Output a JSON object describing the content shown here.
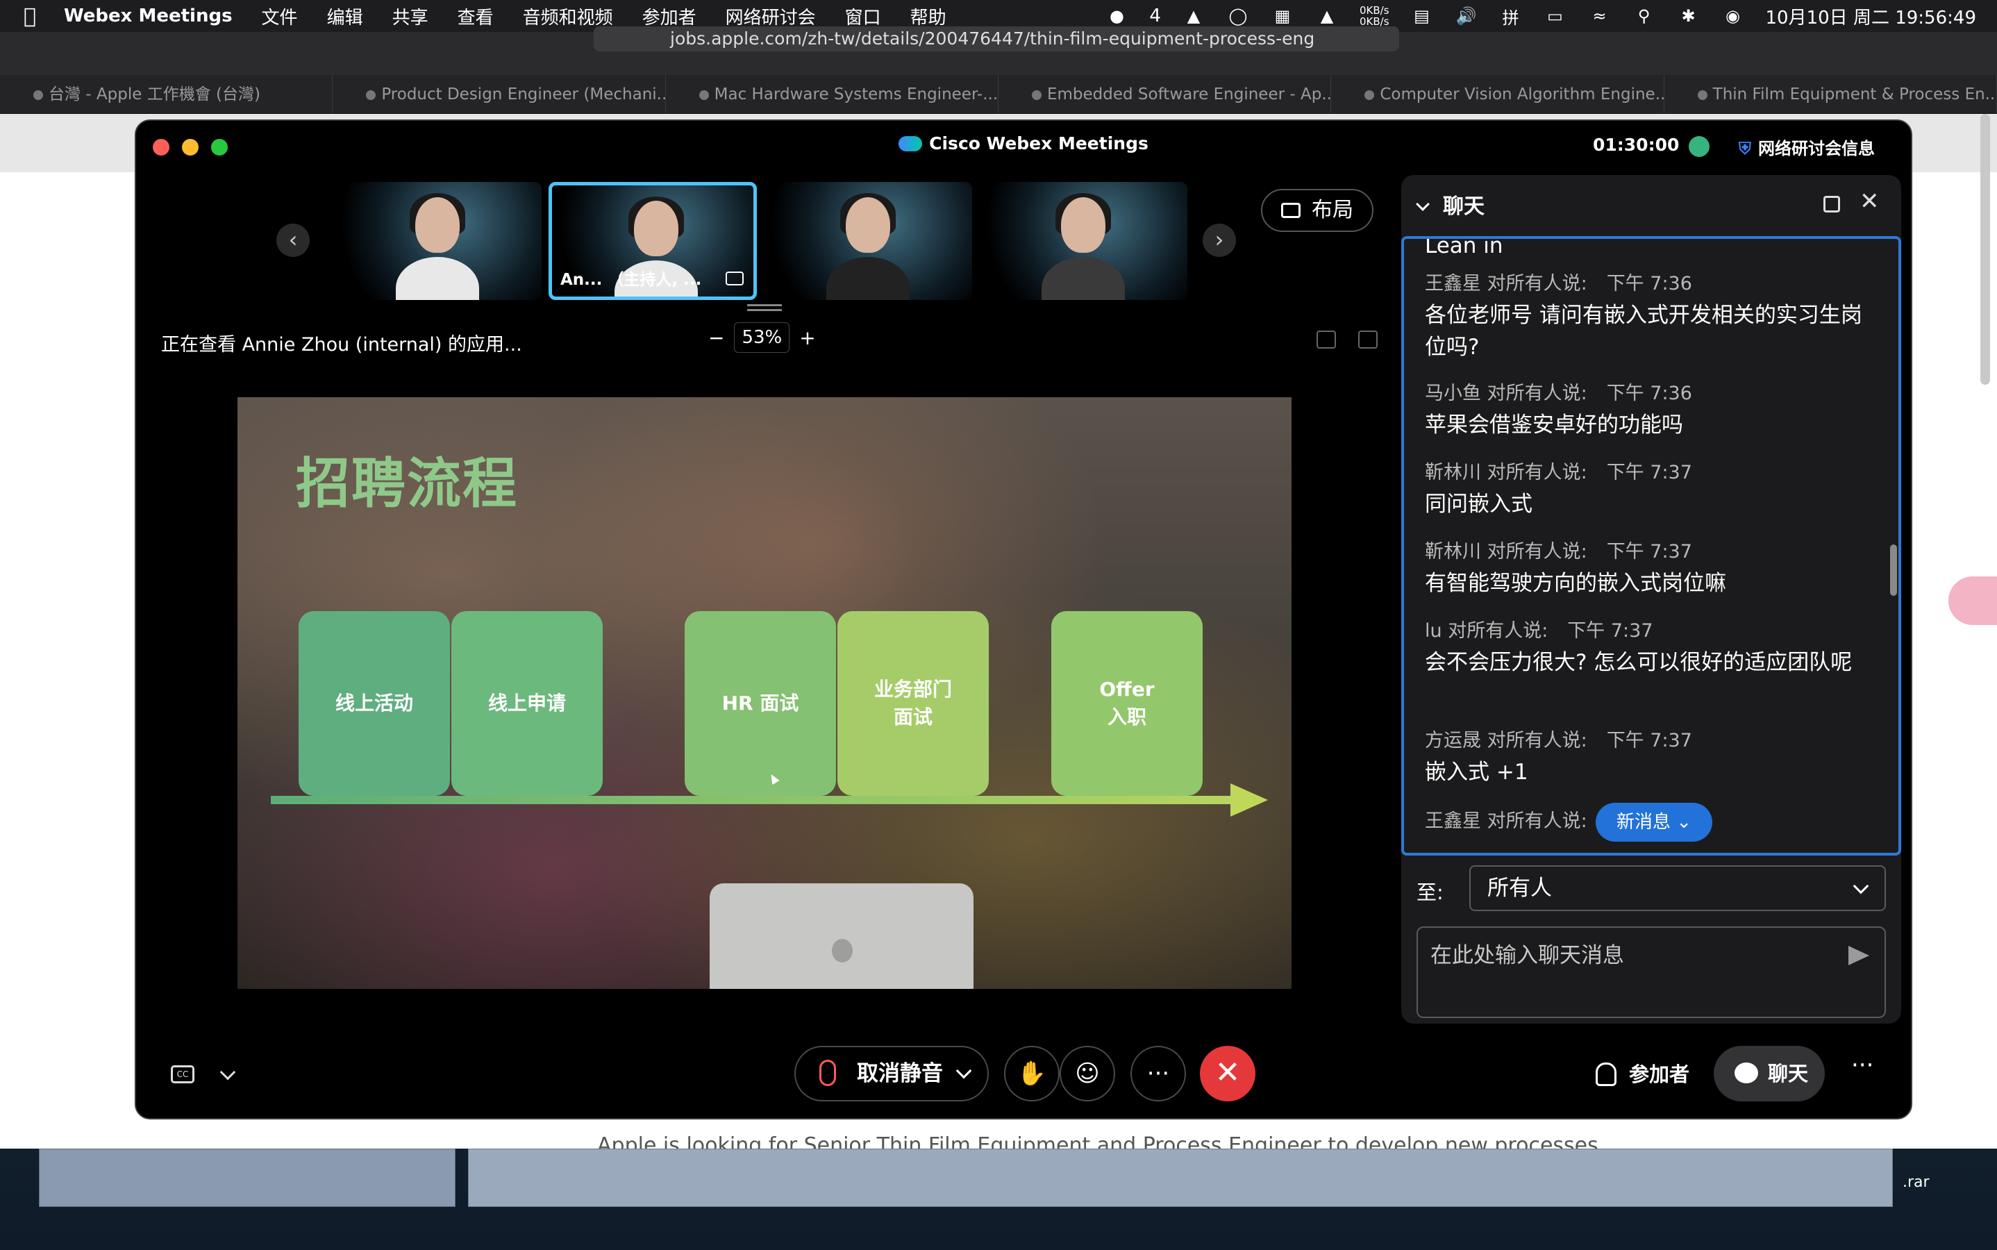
{
  "menubar": {
    "app_name": "Webex Meetings",
    "items": [
      "文件",
      "编辑",
      "共享",
      "查看",
      "音频和视频",
      "参加者",
      "网络研讨会",
      "窗口",
      "帮助"
    ],
    "wechat_count": "4",
    "net_up": "0KB/s",
    "net_down": "0KB/s",
    "input_method": "拼",
    "datetime": "10月10日 周二  19:56:49"
  },
  "browser": {
    "url": "jobs.apple.com/zh-tw/details/200476447/thin-film-equipment-process-eng",
    "tabs": [
      "台灣 - Apple 工作機會 (台灣)",
      "Product Design Engineer (Mechani...",
      "Mac Hardware Systems Engineer-...",
      "Embedded Software Engineer - Ap...",
      "Computer Vision Algorithm Engine...",
      "Thin Film Equipment & Process En..."
    ],
    "page_text": "Apple is looking for Senior Thin Film Equipment and Process Engineer to develop new processes",
    "desktop_file": ".rar"
  },
  "webex": {
    "title": "Cisco Webex Meetings",
    "timer": "01:30:00",
    "webinar_info": "网络研讨会信息",
    "layout_label": "布局",
    "thumbnails": [
      {
        "name": ""
      },
      {
        "name": "An...  （主持人, ..."
      },
      {
        "name": ""
      },
      {
        "name": ""
      }
    ],
    "viewing_label": "正在查看 Annie Zhou (internal) 的应用...",
    "zoom_minus": "−",
    "zoom_value": "53%",
    "zoom_plus": "+",
    "slide": {
      "title": "招聘流程",
      "steps": [
        "线上活动",
        "线上申请",
        "HR 面试",
        "业务部门\n面试",
        "Offer\n入职"
      ]
    },
    "controls": {
      "cc_label": "CC",
      "unmute_label": "取消静音",
      "raise_hand": "✋",
      "reactions": "☺",
      "more": "···",
      "end": "✕",
      "participants_label": "参加者",
      "chat_label": "聊天",
      "more_right": "···"
    }
  },
  "chat": {
    "title": "聊天",
    "cut_text": "Lean in",
    "messages": [
      {
        "sender": "王鑫星 对所有人说:",
        "time": "下午 7:36",
        "text": "各位老师号 请问有嵌入式开发相关的实习生岗位吗?"
      },
      {
        "sender": "马小鱼 对所有人说:",
        "time": "下午 7:36",
        "text": "苹果会借鉴安卓好的功能吗"
      },
      {
        "sender": "靳林川 对所有人说:",
        "time": "下午 7:37",
        "text": "同问嵌入式"
      },
      {
        "sender": "靳林川 对所有人说:",
        "time": "下午 7:37",
        "text": "有智能驾驶方向的嵌入式岗位嘛"
      },
      {
        "sender": "lu 对所有人说:",
        "time": "下午 7:37",
        "text": "会不会压力很大? 怎么可以很好的适应团队呢"
      },
      {
        "sender": "方运晟 对所有人说:",
        "time": "下午 7:37",
        "text": "嵌入式 +1"
      },
      {
        "sender": "王鑫星 对所有人说:",
        "time": "",
        "text": ""
      }
    ],
    "new_message_label": "新消息",
    "to_label": "至:",
    "to_value": "所有人",
    "input_placeholder": "在此处输入聊天消息"
  }
}
